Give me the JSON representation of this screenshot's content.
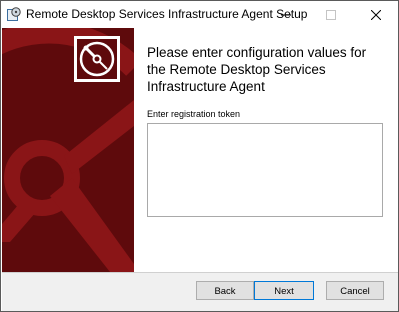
{
  "window": {
    "title": "Remote Desktop Services Infrastructure Agent Setup"
  },
  "icons": {
    "app": "setup-disc-icon",
    "banner": "disc-icon",
    "minimize": "minimize-icon",
    "maximize": "maximize-icon",
    "close": "close-icon"
  },
  "main": {
    "heading": "Please enter configuration values for the Remote Desktop Services Infrastructure Agent",
    "token_label": "Enter registration token",
    "token_value": ""
  },
  "buttons": {
    "back": "Back",
    "next": "Next",
    "cancel": "Cancel"
  },
  "colors": {
    "banner": "#5e0a0c",
    "banner_art": "#8a1517",
    "accent": "#0078d7"
  }
}
